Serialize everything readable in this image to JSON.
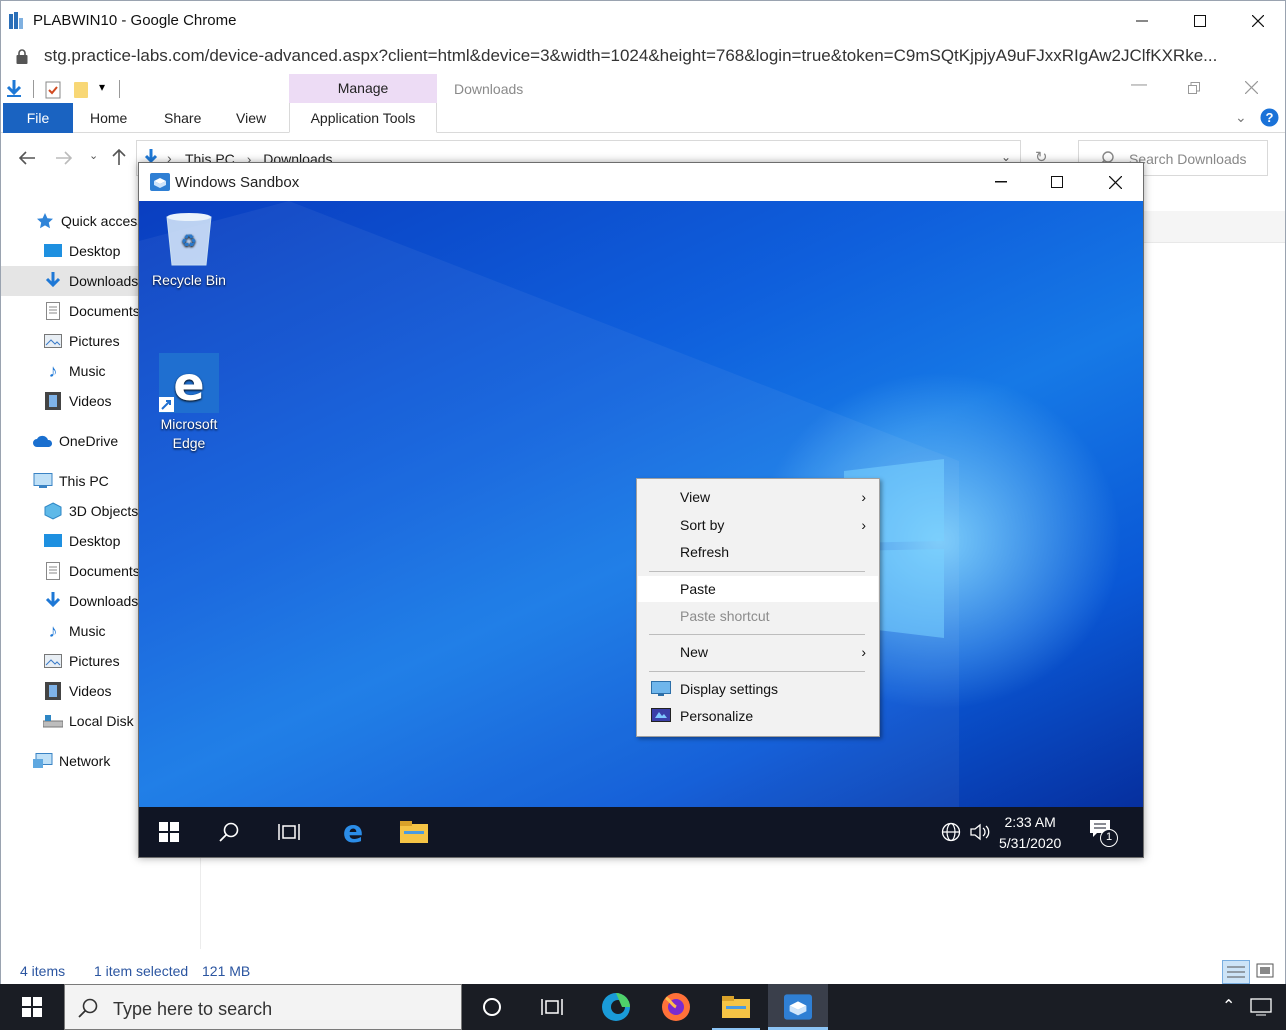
{
  "chrome": {
    "title": "PLABWIN10 - Google Chrome",
    "url": "stg.practice-labs.com/device-advanced.aspx?client=html&device=3&width=1024&height=768&login=true&token=C9mSQtKjpjyA9uFJxxRIgAw2JClfKXRke..."
  },
  "explorer": {
    "manage_tab": "Manage",
    "window_title": "Downloads",
    "tabs": {
      "file": "File",
      "home": "Home",
      "share": "Share",
      "view": "View",
      "application_tools": "Application Tools"
    },
    "breadcrumb": {
      "root": "This PC",
      "folder": "Downloads"
    },
    "search_placeholder": "Search Downloads",
    "nav": {
      "quick_access": "Quick access",
      "qa_desktop": "Desktop",
      "qa_downloads": "Downloads",
      "qa_documents": "Documents",
      "qa_pictures": "Pictures",
      "qa_music": "Music",
      "qa_videos": "Videos",
      "onedrive": "OneDrive",
      "this_pc": "This PC",
      "pc_3d": "3D Objects",
      "pc_desktop": "Desktop",
      "pc_documents": "Documents",
      "pc_downloads": "Downloads",
      "pc_music": "Music",
      "pc_pictures": "Pictures",
      "pc_videos": "Videos",
      "pc_local_disk": "Local Disk (C:)",
      "network": "Network"
    },
    "status": {
      "items": "4 items",
      "selected": "1 item selected",
      "size": "121 MB"
    }
  },
  "sandbox": {
    "title": "Windows Sandbox",
    "desktop_icons": {
      "recycle_bin": "Recycle Bin",
      "edge_line1": "Microsoft",
      "edge_line2": "Edge"
    },
    "context_menu": {
      "view": "View",
      "sort_by": "Sort by",
      "refresh": "Refresh",
      "paste": "Paste",
      "paste_shortcut": "Paste shortcut",
      "new": "New",
      "display_settings": "Display settings",
      "personalize": "Personalize"
    },
    "clock": {
      "time": "2:33 AM",
      "date": "5/31/2020"
    },
    "notification_count": "1"
  },
  "taskbar": {
    "search_placeholder": "Type here to search"
  },
  "colors": {
    "file_tab": "#1a63c1",
    "manage_tab": "#eddcf5",
    "taskbar": "#1a1d24",
    "desktop_blue": "#0f5fdc"
  }
}
